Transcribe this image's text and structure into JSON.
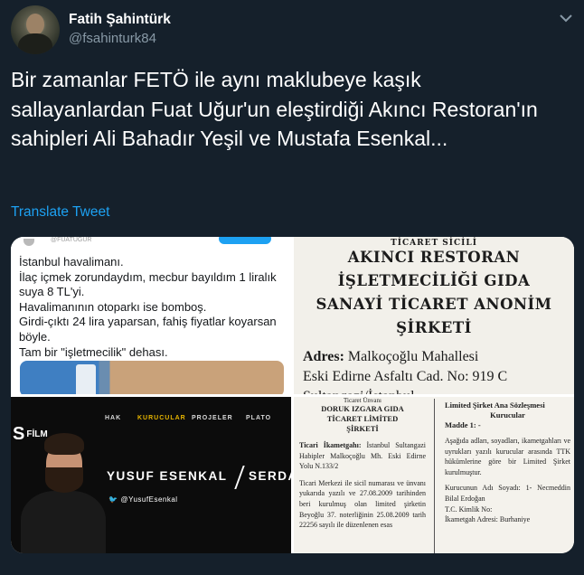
{
  "tweet": {
    "author_name": "Fatih Şahintürk",
    "author_handle": "@fsahinturk84",
    "text": "Bir zamanlar FETÖ ile aynı maklubeye kaşık sallayanlardan Fuat Uğur'un eleştirdiği Akıncı Restoran'ın sahipleri Ali Bahadır Yeşil ve Mustafa Esenkal...",
    "translate_label": "Translate Tweet",
    "link_color": "#1da1f2",
    "background_color": "#15202b"
  },
  "media": {
    "image1": {
      "handle": "@FUATUGUR",
      "lines": [
        "İstanbul havalimanı.",
        "İlaç içmek zorundaydım, mecbur bayıldım 1 liralık suya 8 TL'yi.",
        "Havalimanının otoparkı ise bomboş.",
        "Girdi-çıktı 24 lira yaparsan, fahiş fiyatlar koyarsan böyle.",
        "Tam bir \"işletmecilik\" dehası."
      ]
    },
    "image2": {
      "top_fragment": "TİCARET SİCİLİ",
      "title_lines": [
        "AKINCI RESTORAN",
        "İŞLETMECİLİĞİ GIDA",
        "SANAYİ TİCARET ANONİM",
        "ŞİRKETİ"
      ],
      "address_label": "Adres:",
      "address_line1": "Malkoçoğlu Mahallesi",
      "address_line2": "Eski Edirne Asfaltı Cad. No: 919 C",
      "address_line3": "Sultangazi/İstanbul"
    },
    "image3": {
      "brand": "FİLM",
      "nav": [
        "HAK",
        "KURUCULAR",
        "PROJELER",
        "PLATO"
      ],
      "name": "YUSUF ESENKAL",
      "second_name": "SERDAR",
      "twitter": "@YusufEsenkal"
    },
    "image4": {
      "left_small": "Ticaret Ünvanı",
      "left_title": [
        "DORUK IZGARA GIDA",
        "TİCARET LİMİTED",
        "ŞİRKETİ"
      ],
      "left_p1_label": "Ticari İkametgahı:",
      "left_p1": "İstanbul Sultangazi Habipler Malkoçoğlu Mh. Eski Edirne Yolu N.133/2",
      "left_p2": "Ticari Merkezi ile sicil numarası ve ünvanı yukarıda yazılı ve 27.08.2009 tarihinden beri kurulmuş olan limited şirketin Beyoğlu 37. noterliğinin 25.08.2009 tarih 22256 sayılı ile düzenlenen esas",
      "right_title": [
        "Limited Şirket Ana Sözleşmesi",
        "Kurucular"
      ],
      "right_madde": "Madde 1: -",
      "right_p1": "Aşağıda adları, soyadları, ikametgahları ve uyrukları yazılı kurucular arasında TTK hükümlerine göre bir Limited Şirket kurulmuştur.",
      "right_p2": "Kurucunun Adı Soyadı: 1- Necmeddin Bilal Erdoğan",
      "right_p3": "T.C. Kimlik No:",
      "right_p4": "İkametgah Adresi: Burhaniye"
    }
  }
}
